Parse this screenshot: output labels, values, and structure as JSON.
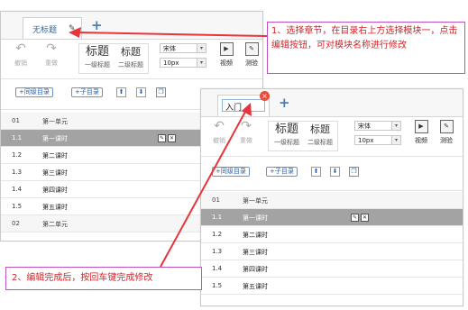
{
  "panel_before": {
    "tab": {
      "title": "无标题",
      "edit_icon": "pencil-icon"
    },
    "add_tab": "+",
    "toolbar": {
      "undo": "撤销",
      "redo": "重做",
      "heading1": {
        "big": "标题",
        "small": "一级标题"
      },
      "heading2": {
        "big": "标题",
        "small": "二级标题"
      },
      "font_family": "宋体",
      "font_size": "10px",
      "video": "视频",
      "test": "测验"
    },
    "actions": {
      "add_same_level": "同级目录",
      "add_child": "子目录"
    },
    "rows": [
      {
        "num": "01",
        "name": "第一单元",
        "kind": "unit"
      },
      {
        "num": "1.1",
        "name": "第一课时",
        "kind": "selected"
      },
      {
        "num": "1.2",
        "name": "第二课时",
        "kind": "lesson"
      },
      {
        "num": "1.3",
        "name": "第三课时",
        "kind": "lesson"
      },
      {
        "num": "1.4",
        "name": "第四课时",
        "kind": "lesson"
      },
      {
        "num": "1.5",
        "name": "第五课时",
        "kind": "lesson"
      },
      {
        "num": "02",
        "name": "第二单元",
        "kind": "unit"
      }
    ]
  },
  "panel_after": {
    "tab": {
      "title": "入门",
      "close": "×"
    },
    "add_tab": "+",
    "toolbar": {
      "undo": "撤销",
      "redo": "重做",
      "heading1": {
        "big": "标题",
        "small": "一级标题"
      },
      "heading2": {
        "big": "标题",
        "small": "二级标题"
      },
      "font_family": "宋体",
      "font_size": "10px",
      "video": "视频",
      "test": "测验"
    },
    "actions": {
      "add_same_level": "同级目录",
      "add_child": "子目录"
    },
    "rows": [
      {
        "num": "01",
        "name": "第一单元",
        "kind": "unit"
      },
      {
        "num": "1.1",
        "name": "第一课时",
        "kind": "selected"
      },
      {
        "num": "1.2",
        "name": "第二课时",
        "kind": "lesson"
      },
      {
        "num": "1.3",
        "name": "第三课时",
        "kind": "lesson"
      },
      {
        "num": "1.4",
        "name": "第四课时",
        "kind": "lesson"
      },
      {
        "num": "1.5",
        "name": "第五课时",
        "kind": "lesson"
      }
    ]
  },
  "callouts": {
    "top": "1、选择章节，在目录右上方选择模块一，点击编辑按钮，可对模块名称进行修改",
    "bottom": "2、编辑完成后，按回车键完成修改"
  },
  "colors": {
    "accent": "#4a7fb8",
    "selected_row": "#a3a3a3",
    "callout_text": "#d2242a",
    "callout_border": "#c24fc6",
    "arrow": "#e8343a"
  }
}
